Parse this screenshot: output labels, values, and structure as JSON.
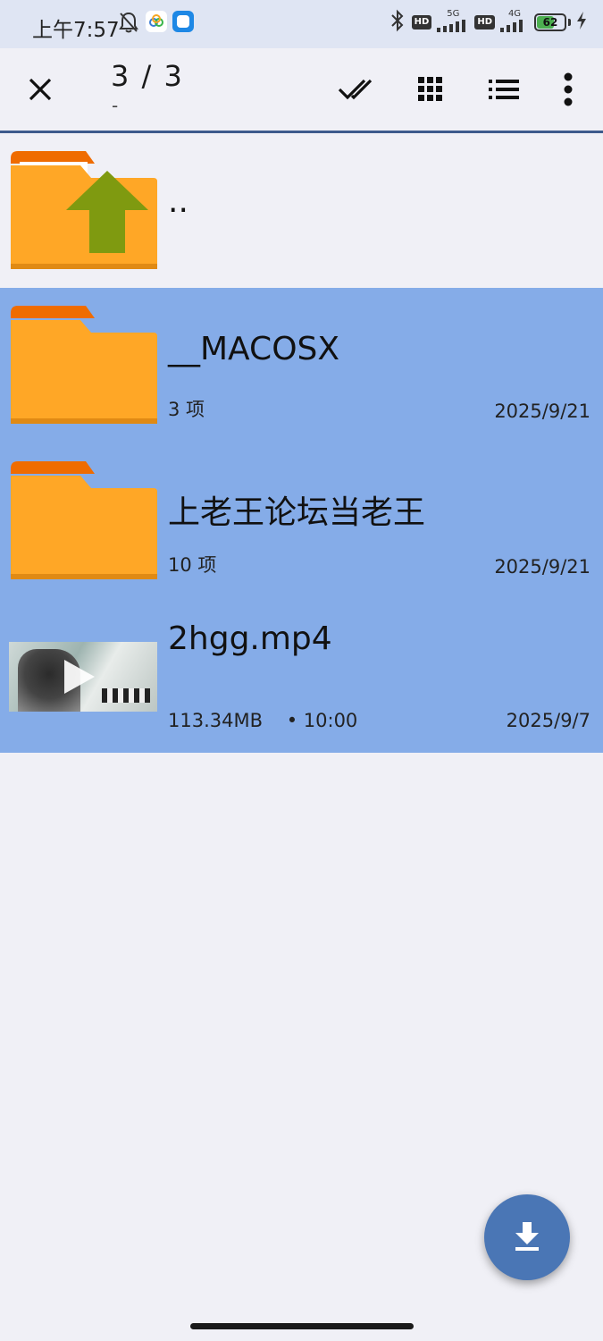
{
  "status_bar": {
    "time": "上午7:57",
    "net1": "5G",
    "net2": "4G",
    "hd1": "HD",
    "hd2": "HD",
    "battery_percent": 62,
    "battery_label": "62"
  },
  "toolbar": {
    "selection_count": "3 / 3",
    "subtitle": "-",
    "icons": [
      "close-icon",
      "select-all-icon",
      "grid-view-icon",
      "list-view-icon",
      "more-vert-icon"
    ]
  },
  "list": {
    "parent": {
      "name": ".."
    },
    "items": [
      {
        "name": "__MACOSX",
        "meta": "3 项",
        "date": "2025/9/21",
        "type": "folder"
      },
      {
        "name": "上老王论坛当老王",
        "meta": "10 项",
        "date": "2025/9/21",
        "type": "folder"
      },
      {
        "name": "2hgg.mp4",
        "meta": "113.34MB    • 10:00",
        "date": "2025/9/7",
        "type": "video"
      }
    ]
  },
  "colors": {
    "selected_row": "#85ace8",
    "folder": "#ffa726",
    "folder_tab": "#ef6c00",
    "fab": "#4a76b5",
    "up_arrow": "#7f9a10"
  }
}
